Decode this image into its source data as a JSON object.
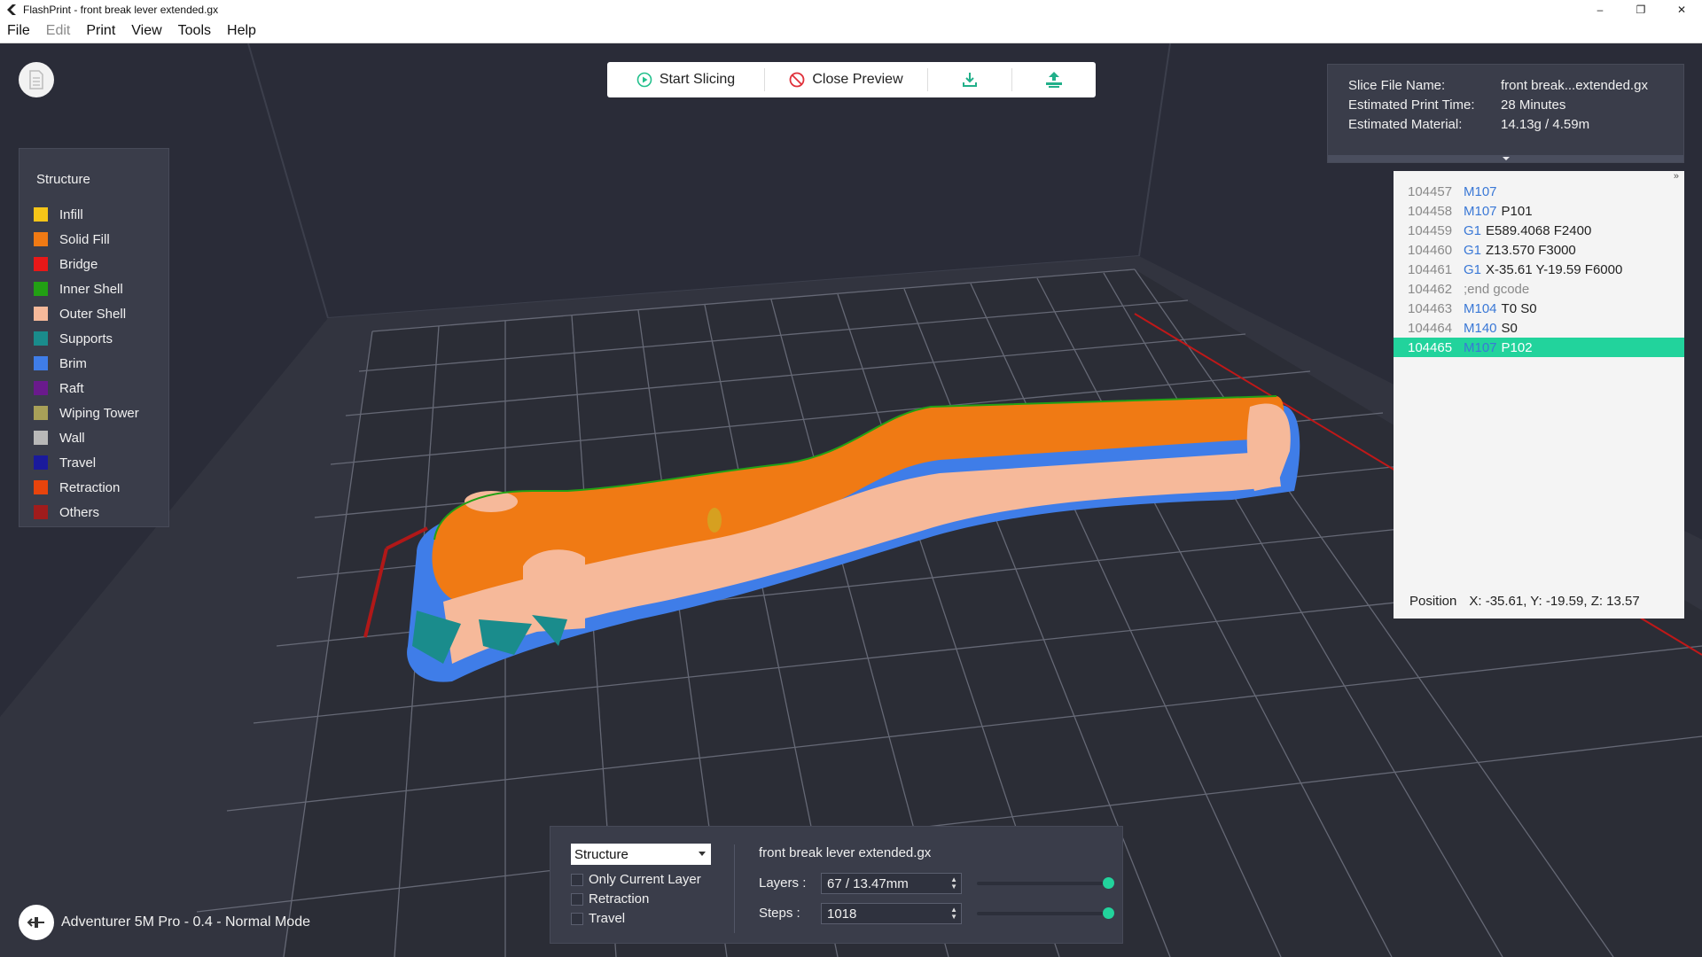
{
  "window": {
    "title": "FlashPrint - front break lever extended.gx",
    "controls": [
      "–",
      "❐",
      "✕"
    ]
  },
  "menu": [
    {
      "label": "File",
      "enabled": true
    },
    {
      "label": "Edit",
      "enabled": false
    },
    {
      "label": "Print",
      "enabled": true
    },
    {
      "label": "View",
      "enabled": true
    },
    {
      "label": "Tools",
      "enabled": true
    },
    {
      "label": "Help",
      "enabled": true
    }
  ],
  "toolbar": {
    "start_label": "Start Slicing",
    "close_label": "Close Preview",
    "export_icon": "download-icon",
    "send_icon": "send-to-printer-icon"
  },
  "legend": {
    "title": "Structure",
    "items": [
      {
        "label": "Infill",
        "color": "#f5c518"
      },
      {
        "label": "Solid Fill",
        "color": "#f07a14"
      },
      {
        "label": "Bridge",
        "color": "#e81818"
      },
      {
        "label": "Inner Shell",
        "color": "#22a014"
      },
      {
        "label": "Outer Shell",
        "color": "#f6b99a"
      },
      {
        "label": "Supports",
        "color": "#1a8c8c"
      },
      {
        "label": "Brim",
        "color": "#3f7de8"
      },
      {
        "label": "Raft",
        "color": "#6a1a8c"
      },
      {
        "label": "Wiping Tower",
        "color": "#a8a058"
      },
      {
        "label": "Wall",
        "color": "#b8b8b8"
      },
      {
        "label": "Travel",
        "color": "#1a1a9c"
      },
      {
        "label": "Retraction",
        "color": "#e8440c"
      },
      {
        "label": "Others",
        "color": "#a01c1c"
      }
    ]
  },
  "slice_info": {
    "file_name_label": "Slice File Name:",
    "file_name": "front break...extended.gx",
    "print_time_label": "Estimated Print Time:",
    "print_time": "28 Minutes",
    "material_label": "Estimated Material:",
    "material": "14.13g / 4.59m"
  },
  "gcode": {
    "lines": [
      {
        "num": "104457",
        "cmd": "M107",
        "args": ""
      },
      {
        "num": "104458",
        "cmd": "M107",
        "args": "P101"
      },
      {
        "num": "104459",
        "cmd": "G1",
        "args": "E589.4068 F2400"
      },
      {
        "num": "104460",
        "cmd": "G1",
        "args": "Z13.570 F3000"
      },
      {
        "num": "104461",
        "cmd": "G1",
        "args": "X-35.61 Y-19.59 F6000"
      },
      {
        "num": "104462",
        "cmd": "",
        "args": ";end gcode"
      },
      {
        "num": "104463",
        "cmd": "M104",
        "args": "T0 S0"
      },
      {
        "num": "104464",
        "cmd": "M140",
        "args": "S0"
      },
      {
        "num": "104465",
        "cmd": "M107",
        "args": "P102"
      }
    ],
    "active_index": 8,
    "position_label": "Position",
    "position_value": "X: -35.61, Y: -19.59, Z: 13.57"
  },
  "bottom": {
    "view_mode": "Structure",
    "only_current_layer": "Only Current Layer",
    "retraction": "Retraction",
    "travel": "Travel",
    "file_name": "front break lever extended.gx",
    "layers_label": "Layers :",
    "layers_value": "67 / 13.47mm",
    "steps_label": "Steps :",
    "steps_value": "1018",
    "layers_slider_fraction": 1.0,
    "steps_slider_fraction": 1.0
  },
  "printer": {
    "status": "Adventurer 5M Pro - 0.4 - Normal Mode"
  },
  "colors": {
    "accent": "#22d39c",
    "gcode_cmd": "#3a78d6",
    "viewport_bg": "#2b2d3a"
  }
}
